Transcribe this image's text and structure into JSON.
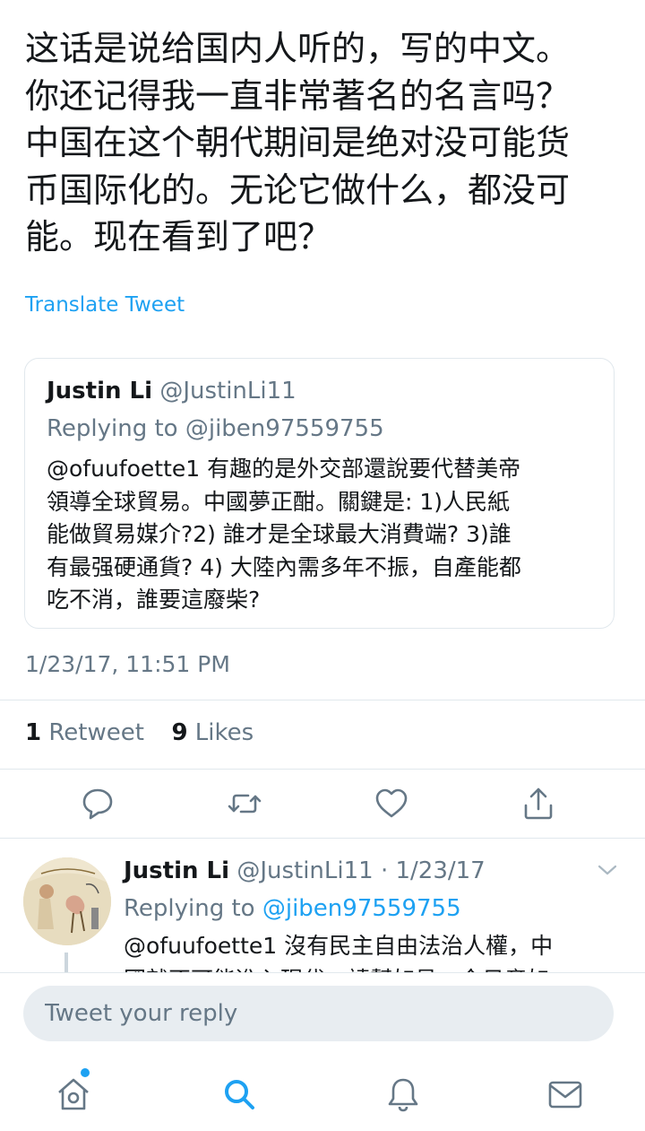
{
  "tweet": {
    "text": "这话是说给国内人听的，写的中文。\n你还记得我一直非常著名的名言吗？\n中国在这个朝代期间是绝对没可能货\n币国际化的。无论它做什么，都没可\n能。现在看到了吧？",
    "translate_label": "Translate Tweet",
    "timestamp": "1/23/17, 11:51 PM"
  },
  "quoted": {
    "name": "Justin Li",
    "handle": "@JustinLi11",
    "replying_to": "Replying to @jiben97559755",
    "text": "@ofuufoette1 有趣的是外交部還說要代替美帝\n領導全球貿易。中國夢正酣。關鍵是: 1)人民紙\n能做貿易媒介?2) 誰才是全球最大消費端? 3)誰\n有最强硬通貨? 4) 大陸內需多年不振，自產能都\n吃不消，誰要這廢柴?"
  },
  "stats": {
    "retweet_count": "1",
    "retweet_label": "Retweet",
    "like_count": "9",
    "like_label": "Likes"
  },
  "actions": [
    "reply-icon",
    "retweet-icon",
    "like-icon",
    "share-icon"
  ],
  "reply": {
    "name": "Justin Li",
    "meta": "@JustinLi11 · 1/23/17",
    "replying_prefix": "Replying to ",
    "replying_handle": "@jiben97559755",
    "text": "@ofuufoette1 沒有民主自由法治人權，中\n國就不可能進入現代，請幫如見，今日產如"
  },
  "composer": {
    "placeholder": "Tweet your reply"
  },
  "tabs": [
    "home-icon",
    "search-icon",
    "notifications-icon",
    "messages-icon"
  ],
  "colors": {
    "accent": "#1da1f2",
    "text": "#14171a",
    "muted": "#657786",
    "border": "#e1e8ed"
  }
}
